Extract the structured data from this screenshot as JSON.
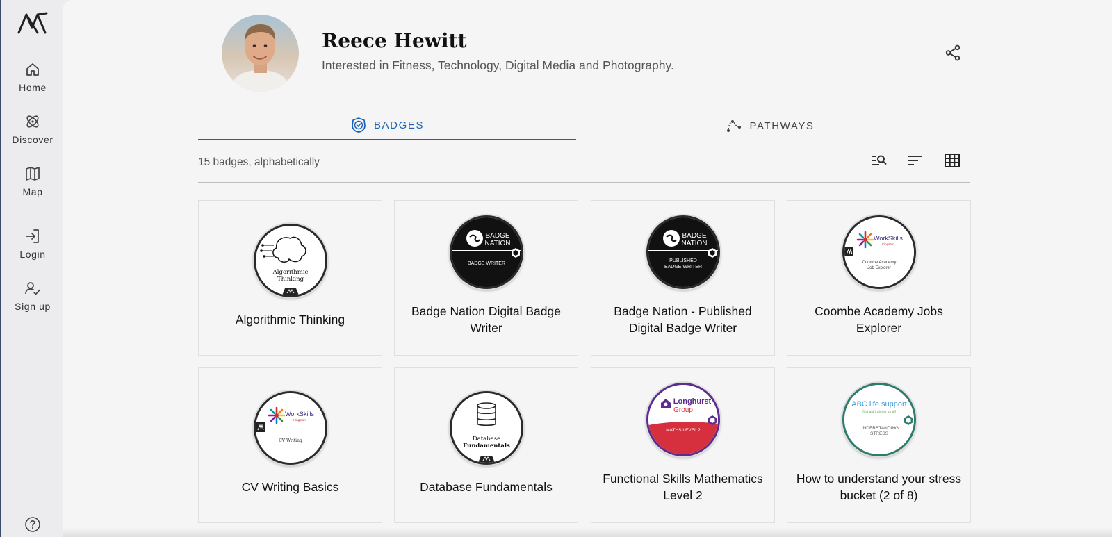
{
  "nav": {
    "items": [
      {
        "label": "Home",
        "icon": "home-icon"
      },
      {
        "label": "Discover",
        "icon": "discover-icon"
      },
      {
        "label": "Map",
        "icon": "map-icon"
      },
      {
        "label": "Login",
        "icon": "login-icon"
      },
      {
        "label": "Sign up",
        "icon": "signup-icon"
      }
    ],
    "help_icon": "help-icon"
  },
  "profile": {
    "name": "Reece Hewitt",
    "bio": "Interested in Fitness, Technology, Digital Media and Photography."
  },
  "tabs": [
    {
      "label": "BADGES",
      "icon": "badge-icon",
      "active": true
    },
    {
      "label": "PATHWAYS",
      "icon": "pathways-icon",
      "active": false
    }
  ],
  "list": {
    "info": "15 badges, alphabetically",
    "tools": [
      "filter-search-icon",
      "sort-icon",
      "grid-view-icon"
    ]
  },
  "colors": {
    "accent": "#1a62b5",
    "longhurst_purple": "#5b2d8e",
    "longhurst_red": "#d6303e",
    "abc_green": "#2d7b6a"
  },
  "badges": [
    {
      "title": "Algorithmic Thinking",
      "image_text": [
        "Algorithmic",
        "Thinking"
      ]
    },
    {
      "title": "Badge Nation Digital Badge Writer",
      "image_text": [
        "BADGE",
        "NATION",
        "BADGE WRITER"
      ]
    },
    {
      "title": "Badge Nation - Published Digital Badge Writer",
      "image_text": [
        "BADGE",
        "NATION",
        "PUBLISHED",
        "BADGE WRITER"
      ]
    },
    {
      "title": "Coombe Academy Jobs Explorer",
      "image_text": [
        "WorkSkills",
        "Kingston",
        "Coombe Academy",
        "Job Explorer"
      ]
    },
    {
      "title": "CV Writing Basics",
      "image_text": [
        "WorkSkills",
        "Kingston",
        "CV Writing"
      ]
    },
    {
      "title": "Database Fundamentals",
      "image_text": [
        "Database",
        "Fundamentals"
      ]
    },
    {
      "title": "Functional Skills Mathematics Level 2",
      "image_text": [
        "Longhurst",
        "Group",
        "MATHS LEVEL 2"
      ]
    },
    {
      "title": "How to understand your stress bucket (2 of 8)",
      "image_text": [
        "ABC life support",
        "first aid training for all",
        "UNDERSTANDING",
        "STRESS"
      ]
    }
  ]
}
